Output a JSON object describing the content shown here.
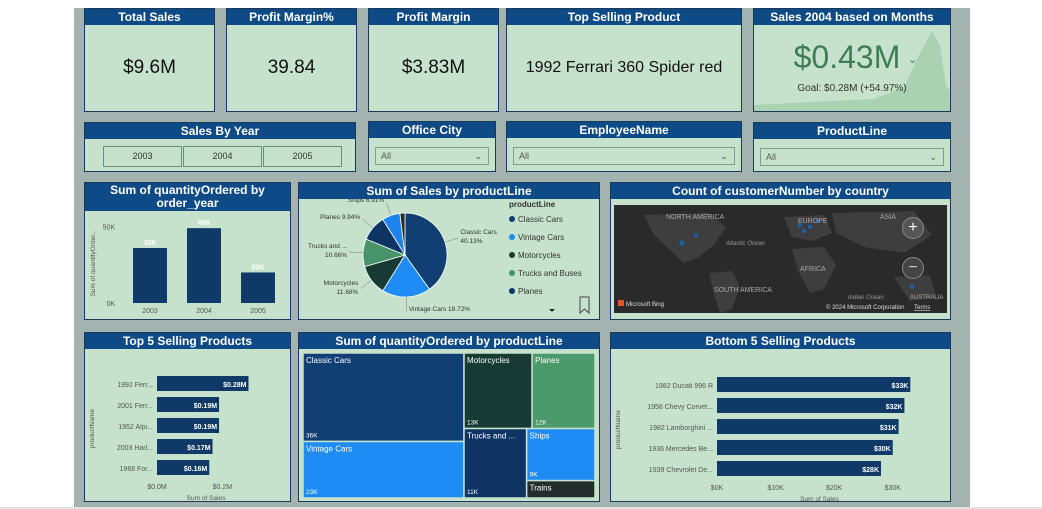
{
  "colors": {
    "header": "#0e4a86",
    "card": "#c6e2cc",
    "bar": "#0f3a68",
    "map_bg": "#2b2b2b"
  },
  "kpis": {
    "total_sales": {
      "title": "Total Sales",
      "value": "$9.6M"
    },
    "profit_margin_pct": {
      "title": "Profit Margin%",
      "value": "39.84"
    },
    "profit_margin": {
      "title": "Profit Margin",
      "value": "$3.83M"
    },
    "top_product": {
      "title": "Top Selling Product",
      "value": "1992 Ferrari 360 Spider red"
    },
    "sales_2004": {
      "title": "Sales 2004 based on Months",
      "value": "$0.43M",
      "goal": "Goal: $0.28M (+54.97%)"
    }
  },
  "slicers": {
    "year": {
      "title": "Sales By Year",
      "options": [
        "2003",
        "2004",
        "2005"
      ]
    },
    "office_city": {
      "title": "Office City",
      "value": "All"
    },
    "employee": {
      "title": "EmployeeName",
      "value": "All"
    },
    "product_line": {
      "title": "ProductLine",
      "value": "All"
    }
  },
  "map": {
    "title": "Count of customerNumber by country",
    "labels": [
      "NORTH AMERICA",
      "EUROPE",
      "ASIA",
      "Atlantic Ocean",
      "AFRICA",
      "SOUTH AMERICA",
      "Indian Ocean",
      "AUSTRALIA"
    ],
    "bing": "Microsoft Bing",
    "copyright": "© 2024 Microsoft Corporation",
    "terms": "Terms",
    "zoom_in": "+",
    "zoom_out": "−"
  },
  "chart_data": [
    {
      "id": "qty_by_year",
      "type": "bar",
      "title": "Sum of quantityOrdered by order_year",
      "ylabel": "Sum of quantityOrder...",
      "categories": [
        "2003",
        "2004",
        "2005"
      ],
      "values": [
        36000,
        49000,
        20000
      ],
      "data_labels": [
        "36K",
        "49K",
        "20K"
      ],
      "ytick_labels": [
        "0K",
        "50K"
      ],
      "ylim": [
        0,
        55000
      ]
    },
    {
      "id": "sales_by_productline",
      "type": "pie",
      "title": "Sum of Sales by productLine",
      "legend_title": "productLine",
      "legend_visible": [
        "Classic Cars",
        "Vintage Cars",
        "Motorcycles",
        "Trucks and Buses",
        "Planes"
      ],
      "slices": [
        {
          "name": "Classic Cars",
          "value": 40.13,
          "label": [
            "Classic Cars",
            "40.13%"
          ],
          "color": "#113e73"
        },
        {
          "name": "Vintage Cars",
          "value": 18.72,
          "label": [
            "Vintage Cars 18.72%"
          ],
          "color": "#1f8cf5"
        },
        {
          "name": "Motorcycles",
          "value": 11.68,
          "label": [
            "Motorcycles",
            "11.68%"
          ],
          "color": "#173a34"
        },
        {
          "name": "Trucks and Buses",
          "value": 10.66,
          "label": [
            "Trucks and ...",
            "10.66%"
          ],
          "color": "#47946b"
        },
        {
          "name": "Planes",
          "value": 9.94,
          "label": [
            "Planes 9.94%"
          ],
          "color": "#0d3463"
        },
        {
          "name": "Ships",
          "value": 6.91,
          "label": [
            "Ships 6.91%"
          ],
          "color": "#1d84ee"
        },
        {
          "name": "Trains",
          "value": 1.96,
          "label": [],
          "color": "#232e2c"
        }
      ]
    },
    {
      "id": "top5",
      "type": "bar",
      "orientation": "horizontal",
      "title": "Top 5 Selling Products",
      "ylabel": "productName",
      "xlabel": "Sum of Sales",
      "categories": [
        "1992 Ferr...",
        "2001 Ferr...",
        "1952 Alpi...",
        "2003 Harl...",
        "1968 For..."
      ],
      "values": [
        0.28,
        0.19,
        0.19,
        0.17,
        0.16
      ],
      "data_labels": [
        "$0.28M",
        "$0.19M",
        "$0.19M",
        "$0.17M",
        "$0.16M"
      ],
      "xtick_labels": [
        "$0.0M",
        "$0.2M"
      ],
      "xlim": [
        0,
        0.3
      ]
    },
    {
      "id": "qty_treemap",
      "type": "treemap",
      "title": "Sum of quantityOrdered by productLine",
      "items": [
        {
          "name": "Classic Cars",
          "label": "36K",
          "value": 36,
          "color": "#113e73"
        },
        {
          "name": "Vintage Cars",
          "label": "23K",
          "value": 23,
          "color": "#1f8cf5"
        },
        {
          "name": "Motorcycles",
          "label": "13K",
          "value": 13,
          "color": "#173a34"
        },
        {
          "name": "Planes",
          "label": "12K",
          "value": 12,
          "color": "#4a9a6c"
        },
        {
          "name": "Trucks and ...",
          "label": "11K",
          "value": 11,
          "color": "#0d3463"
        },
        {
          "name": "Ships",
          "label": "9K",
          "value": 9,
          "color": "#1f8cf5"
        },
        {
          "name": "Trains",
          "label": "",
          "value": 3,
          "color": "#232e2c"
        }
      ]
    },
    {
      "id": "bottom5",
      "type": "bar",
      "orientation": "horizontal",
      "title": "Bottom 5 Selling Products",
      "ylabel": "productName",
      "xlabel": "Sum of Sales",
      "categories": [
        "1982 Ducati 996 R",
        "1958 Chevy Corvet...",
        "1982 Lamborghini ...",
        "1936 Mercedes Be...",
        "1939 Chevrolet De..."
      ],
      "values": [
        33,
        32,
        31,
        30,
        28
      ],
      "data_labels": [
        "$33K",
        "$32K",
        "$31K",
        "$30K",
        "$28K"
      ],
      "xtick_labels": [
        "$0K",
        "$10K",
        "$20K",
        "$30K"
      ],
      "xlim": [
        0,
        35
      ]
    }
  ]
}
